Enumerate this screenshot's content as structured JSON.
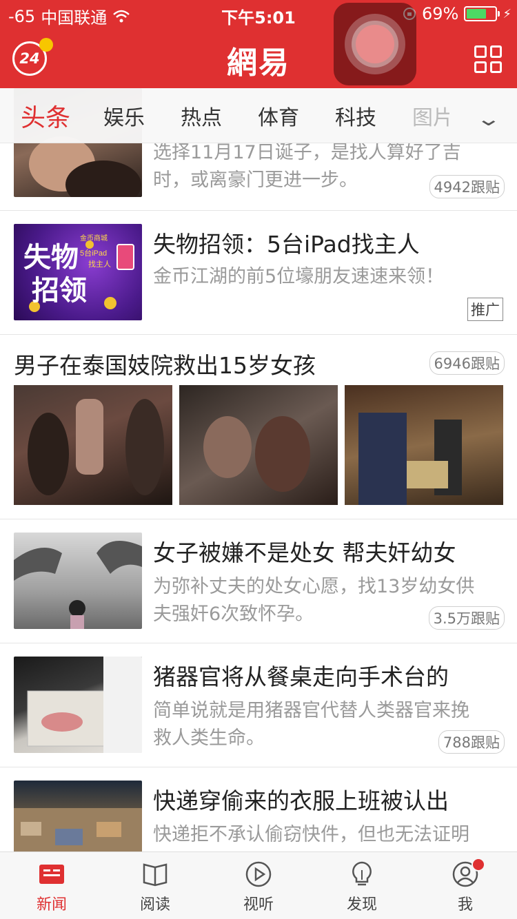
{
  "status_bar": {
    "signal": "-65",
    "carrier": "中国联通",
    "time": "下午5:01",
    "battery_percent": "69%",
    "battery_level": 0.69,
    "battery_color": "#4cd964"
  },
  "header": {
    "badge_text": "24",
    "brand": "網易",
    "accent_color": "#df3031"
  },
  "category_tabs": [
    {
      "label": "头条",
      "active": true
    },
    {
      "label": "娱乐"
    },
    {
      "label": "热点"
    },
    {
      "label": "体育"
    },
    {
      "label": "科技"
    },
    {
      "label": "图片"
    }
  ],
  "feed": {
    "partial_item": {
      "desc_line1": "选择11月17日诞子，是找人算好了吉",
      "desc_line2": "时，或离豪门更进一步。",
      "replies": "4942跟贴"
    },
    "ad_item": {
      "title": "失物招领：5台iPad找主人",
      "desc": "金币江湖的前5位壕朋友速速来领！",
      "tag": "推广",
      "thumb_text_1": "失物",
      "thumb_text_2": "招领",
      "thumb_caption": "5台iPad",
      "thumb_caption_2": "找主人",
      "thumb_caption_3": "金币商城"
    },
    "gallery_item": {
      "title": "男子在泰国妓院救出15岁女孩",
      "replies": "6946跟贴"
    },
    "items": [
      {
        "title": "女子被嫌不是处女 帮夫奸幼女",
        "desc_line1": "为弥补丈夫的处女心愿，找13岁幼女供",
        "desc_line2": "夫强奸6次致怀孕。",
        "replies": "3.5万跟贴"
      },
      {
        "title": "猪器官将从餐桌走向手术台的",
        "desc_line1": "简单说就是用猪器官代替人类器官来挽",
        "desc_line2": "救人类生命。",
        "replies": "788跟贴"
      },
      {
        "title": "快递穿偷来的衣服上班被认出",
        "desc_line1": "快递拒不承认偷窃快件，但也无法证明"
      }
    ]
  },
  "tab_bar": [
    {
      "label": "新闻",
      "icon": "news-icon",
      "active": true
    },
    {
      "label": "阅读",
      "icon": "book-icon"
    },
    {
      "label": "视听",
      "icon": "play-icon"
    },
    {
      "label": "发现",
      "icon": "bulb-icon"
    },
    {
      "label": "我",
      "icon": "user-icon",
      "has_notification": true
    }
  ]
}
